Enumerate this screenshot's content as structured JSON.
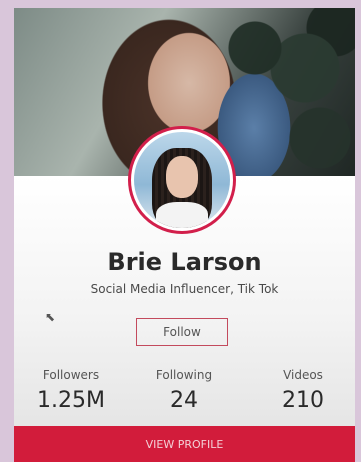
{
  "profile": {
    "name": "Brie Larson",
    "subtitle": "Social Media Influencer, Tik Tok",
    "follow_label": "Follow",
    "view_profile_label": "VIEW PROFILE"
  },
  "stats": [
    {
      "label": "Followers",
      "value": "1.25M"
    },
    {
      "label": "Following",
      "value": "24"
    },
    {
      "label": "Videos",
      "value": "210"
    }
  ],
  "colors": {
    "accent": "#d21c3b",
    "page_background": "#d9c6da"
  },
  "icons": {
    "cursor": "mouse-pointer-icon"
  }
}
